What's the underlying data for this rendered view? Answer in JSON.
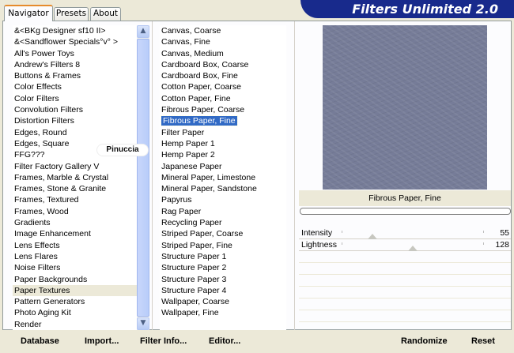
{
  "tabs": [
    "Navigator",
    "Presets",
    "About"
  ],
  "banner": {
    "title": "Filters Unlimited 2.0"
  },
  "categories": [
    "&<BKg Designer sf10 II>",
    "&<Sandflower Specials°v° >",
    "All's Power Toys",
    "Andrew's Filters 8",
    "Buttons & Frames",
    "Color Effects",
    "Color Filters",
    "Convolution Filters",
    "Distortion Filters",
    "Edges, Round",
    "Edges, Square",
    "FFG???",
    "Filter Factory Gallery V",
    "Frames, Marble & Crystal",
    "Frames, Stone & Granite",
    "Frames, Textured",
    "Frames, Wood",
    "Gradients",
    "Image Enhancement",
    "Lens Effects",
    "Lens Flares",
    "Noise Filters",
    "Paper Backgrounds",
    "Paper Textures",
    "Pattern Generators",
    "Photo Aging Kit",
    "Render"
  ],
  "selected_category": "Paper Textures",
  "filters": [
    "Canvas, Coarse",
    "Canvas, Fine",
    "Canvas, Medium",
    "Cardboard Box, Coarse",
    "Cardboard Box, Fine",
    "Cotton Paper, Coarse",
    "Cotton Paper, Fine",
    "Fibrous Paper, Coarse",
    "Fibrous Paper, Fine",
    "Filter Paper",
    "Hemp Paper 1",
    "Hemp Paper 2",
    "Japanese Paper",
    "Mineral Paper, Limestone",
    "Mineral Paper, Sandstone",
    "Papyrus",
    "Rag Paper",
    "Recycling Paper",
    "Striped Paper, Coarse",
    "Striped Paper, Fine",
    "Structure Paper 1",
    "Structure Paper 2",
    "Structure Paper 3",
    "Structure Paper 4",
    "Wallpaper, Coarse",
    "Wallpaper, Fine"
  ],
  "selected_filter": "Fibrous Paper, Fine",
  "current_filter_name": "Fibrous Paper, Fine",
  "params": [
    {
      "label": "Intensity",
      "value": "55",
      "fraction": 0.216
    },
    {
      "label": "Lightness",
      "value": "128",
      "fraction": 0.502
    }
  ],
  "watermark": "Pinuccia",
  "buttons": {
    "database": "Database",
    "import": "Import...",
    "filter_info": "Filter Info...",
    "editor": "Editor...",
    "randomize": "Randomize",
    "reset": "Reset"
  },
  "colors": {
    "banner": "#182a8c",
    "selection": "#316ac5",
    "tab_accent": "#e68b2c"
  }
}
